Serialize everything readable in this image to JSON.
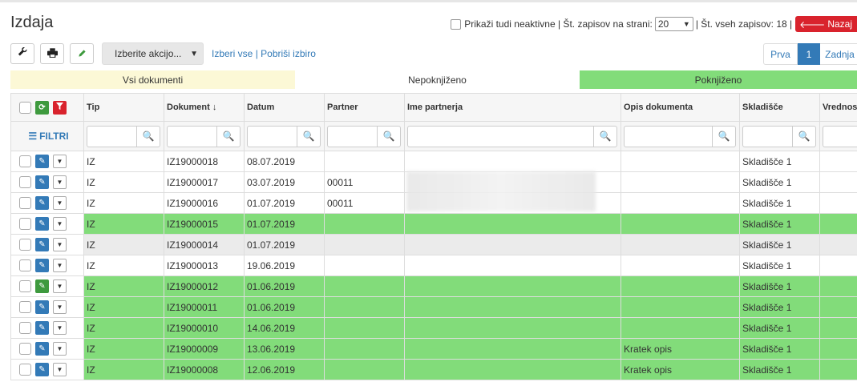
{
  "page": {
    "title": "Izdaja",
    "show_inactive_label": "Prikaži tudi neaktivne",
    "per_page_label": "| Št. zapisov na strani:",
    "per_page_value": "20",
    "total_label": "| Št. vseh zapisov: 18 |",
    "back_label": "Nazaj"
  },
  "toolbar": {
    "action_select": "Izberite akcijo...",
    "select_all": "Izberi vse",
    "separator": "|",
    "clear_selection": "Pobriši izbiro"
  },
  "pager": {
    "first": "Prva",
    "current": "1",
    "last": "Zadnja"
  },
  "tabs": {
    "all": "Vsi dokumenti",
    "unposted": "Nepoknjiženo",
    "posted": "Poknjiženo"
  },
  "colors": {
    "posted_green": "#82dc7a",
    "all_yellow": "#fcf8d6",
    "accent_blue": "#337ab7",
    "danger_red": "#d9232d"
  },
  "table": {
    "filters_label": "FILTRI",
    "columns": [
      "Tip",
      "Dokument",
      "Datum",
      "Partner",
      "Ime partnerja",
      "Opis dokumenta",
      "Skladišče",
      "Vrednost"
    ],
    "rows": [
      {
        "tip": "IZ",
        "dokument": "IZ19000018",
        "datum": "08.07.2019",
        "partner": "",
        "ime": "",
        "opis": "",
        "skladisce": "Skladišče 1",
        "status": "white",
        "edit": "blue"
      },
      {
        "tip": "IZ",
        "dokument": "IZ19000017",
        "datum": "03.07.2019",
        "partner": "00011",
        "ime": "",
        "opis": "",
        "skladisce": "Skladišče 1",
        "status": "white",
        "edit": "blue"
      },
      {
        "tip": "IZ",
        "dokument": "IZ19000016",
        "datum": "01.07.2019",
        "partner": "00011",
        "ime": "",
        "opis": "",
        "skladisce": "Skladišče 1",
        "status": "white",
        "edit": "blue"
      },
      {
        "tip": "IZ",
        "dokument": "IZ19000015",
        "datum": "01.07.2019",
        "partner": "",
        "ime": "",
        "opis": "",
        "skladisce": "Skladišče 1",
        "status": "green",
        "edit": "blue"
      },
      {
        "tip": "IZ",
        "dokument": "IZ19000014",
        "datum": "01.07.2019",
        "partner": "",
        "ime": "",
        "opis": "",
        "skladisce": "Skladišče 1",
        "status": "grey",
        "edit": "blue"
      },
      {
        "tip": "IZ",
        "dokument": "IZ19000013",
        "datum": "19.06.2019",
        "partner": "",
        "ime": "",
        "opis": "",
        "skladisce": "Skladišče 1",
        "status": "white",
        "edit": "blue"
      },
      {
        "tip": "IZ",
        "dokument": "IZ19000012",
        "datum": "01.06.2019",
        "partner": "",
        "ime": "",
        "opis": "",
        "skladisce": "Skladišče 1",
        "status": "green",
        "edit": "green"
      },
      {
        "tip": "IZ",
        "dokument": "IZ19000011",
        "datum": "01.06.2019",
        "partner": "",
        "ime": "",
        "opis": "",
        "skladisce": "Skladišče 1",
        "status": "green",
        "edit": "blue"
      },
      {
        "tip": "IZ",
        "dokument": "IZ19000010",
        "datum": "14.06.2019",
        "partner": "",
        "ime": "",
        "opis": "",
        "skladisce": "Skladišče 1",
        "status": "green",
        "edit": "blue"
      },
      {
        "tip": "IZ",
        "dokument": "IZ19000009",
        "datum": "13.06.2019",
        "partner": "",
        "ime": "",
        "opis": "Kratek opis",
        "skladisce": "Skladišče 1",
        "status": "green",
        "edit": "blue"
      },
      {
        "tip": "IZ",
        "dokument": "IZ19000008",
        "datum": "12.06.2019",
        "partner": "",
        "ime": "",
        "opis": "Kratek opis",
        "skladisce": "Skladišče 1",
        "status": "green",
        "edit": "blue"
      }
    ]
  }
}
